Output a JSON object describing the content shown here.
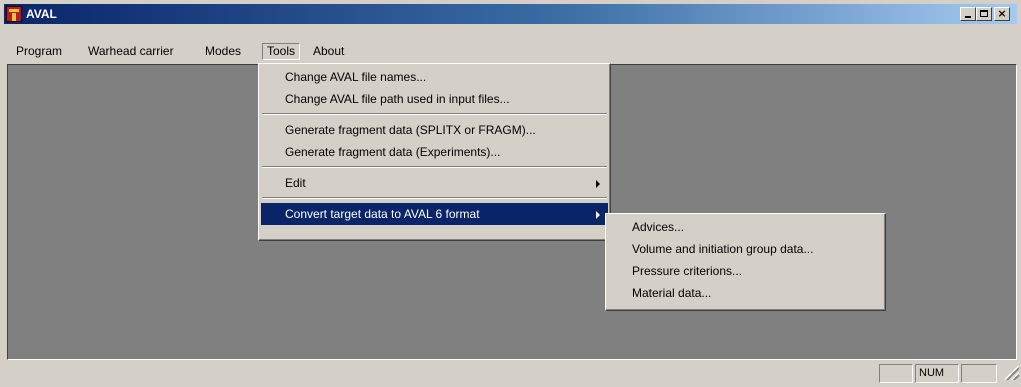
{
  "window": {
    "title": "AVAL",
    "min_glyph": "",
    "max_glyph": "",
    "close_glyph": "×"
  },
  "menubar": {
    "items": [
      "Program",
      "Warhead carrier",
      "Modes",
      "Tools",
      "About"
    ],
    "active": "Tools"
  },
  "tools_menu": {
    "items": [
      "Change AVAL file names...",
      "Change AVAL file path used in input files...",
      "Generate fragment data (SPLITX or FRAGM)...",
      "Generate fragment data (Experiments)...",
      "Edit",
      "Convert target data to AVAL 6 format"
    ],
    "highlighted": "Convert target data to AVAL 6 format"
  },
  "convert_submenu": {
    "items": [
      "Advices...",
      "Volume and initiation group data...",
      "Pressure criterions...",
      "Material data..."
    ]
  },
  "statusbar": {
    "panel1": "",
    "num": "NUM",
    "panel3": ""
  },
  "colors": {
    "face": "#d4d0c8",
    "workspace": "#808080",
    "highlight": "#0a246a",
    "title_gradient_start": "#0a246a",
    "title_gradient_end": "#a6caf0"
  },
  "icons": {
    "app": "aval-app-icon",
    "minimize": "minimize-icon",
    "maximize": "maximize-icon",
    "close": "close-icon",
    "submenu": "submenu-arrow-icon",
    "grip": "resize-grip-icon"
  }
}
